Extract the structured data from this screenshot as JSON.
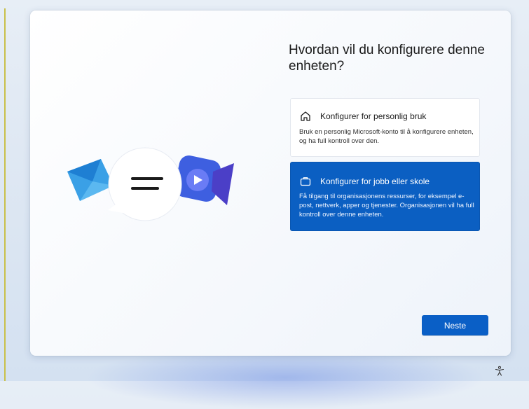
{
  "dialog": {
    "title": "Hvordan vil du konfigurere denne enheten?",
    "options": [
      {
        "icon": "home-icon",
        "label": "Konfigurer for personlig bruk",
        "description": "Bruk en personlig Microsoft-konto til å konfigurere enheten, og ha full kontroll over den.",
        "selected": false
      },
      {
        "icon": "briefcase-icon",
        "label": "Konfigurer for jobb eller skole",
        "description": "Få tilgang til organisasjonens ressurser, for eksempel e-post, nettverk, apper og tjenester. Organisasjonen vil ha full kontroll over denne enheten.",
        "selected": true
      }
    ],
    "next_label": "Neste"
  },
  "illustration": {
    "items": [
      "mail-icon",
      "chat-bubble-icon",
      "video-call-icon"
    ]
  },
  "footer": {
    "icon": "accessibility-icon"
  },
  "colors": {
    "accent": "#0b5fc2",
    "card_bg": "#ffffff"
  }
}
